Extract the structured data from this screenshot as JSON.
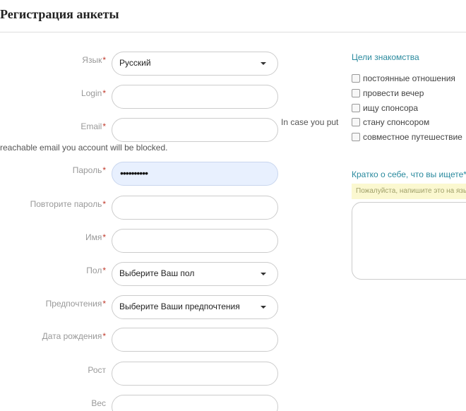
{
  "page": {
    "title": "Регистрация анкеты"
  },
  "form": {
    "required_mark": "*",
    "fields": {
      "language": {
        "label": "Язык",
        "value": "Русский"
      },
      "login": {
        "label": "Login",
        "value": ""
      },
      "email": {
        "label": "Email",
        "value": ""
      },
      "password": {
        "label": "Пароль",
        "value": "••••••••••"
      },
      "password_repeat": {
        "label": "Повторите пароль",
        "value": ""
      },
      "name": {
        "label": "Имя",
        "value": ""
      },
      "gender": {
        "label": "Пол",
        "value": "Выберите Ваш пол"
      },
      "preferences": {
        "label": "Предпочтения",
        "value": "Выберите Ваши предпочтения"
      },
      "birthdate": {
        "label": "Дата рождения",
        "value": ""
      },
      "height": {
        "label": "Рост",
        "value": ""
      },
      "weight": {
        "label": "Вес",
        "value": ""
      }
    },
    "email_note_line1": "In case you put",
    "email_note_line2": "reachable email you account will be blocked."
  },
  "goals": {
    "heading": "Цели знакомства",
    "items": [
      {
        "label": "постоянные отношения",
        "checked": false
      },
      {
        "label": "провести вечер",
        "checked": false
      },
      {
        "label": "ищу спонсора",
        "checked": false
      },
      {
        "label": "стану спонсором",
        "checked": false
      },
      {
        "label": "совместное путешествие",
        "checked": false
      }
    ]
  },
  "about": {
    "heading": "Кратко о себе, что вы ищете*",
    "hint": "Пожалуйста, напишите это на языке",
    "value": ""
  }
}
